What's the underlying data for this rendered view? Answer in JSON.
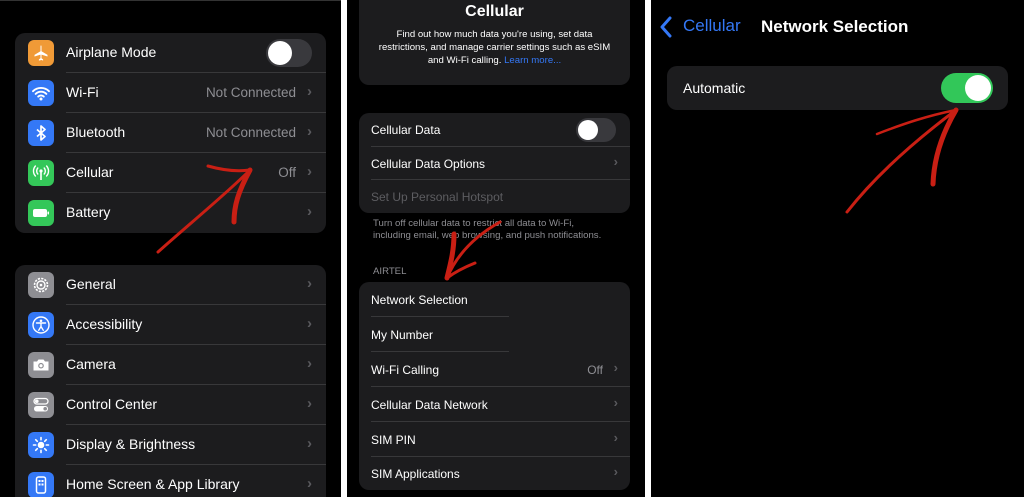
{
  "settings": {
    "group1": [
      {
        "label": "Airplane Mode",
        "icon": "airplane-icon",
        "color": "#f09a37",
        "toggle": "off"
      },
      {
        "label": "Wi-Fi",
        "value": "Not Connected",
        "icon": "wifi-icon",
        "color": "#3478f6"
      },
      {
        "label": "Bluetooth",
        "value": "Not Connected",
        "icon": "bluetooth-icon",
        "color": "#3478f6"
      },
      {
        "label": "Cellular",
        "value": "Off",
        "icon": "antenna-icon",
        "color": "#34c759"
      },
      {
        "label": "Battery",
        "icon": "battery-icon",
        "color": "#34c759"
      }
    ],
    "group2": [
      {
        "label": "General",
        "icon": "gear-icon",
        "color": "#8e8e93"
      },
      {
        "label": "Accessibility",
        "icon": "accessibility-icon",
        "color": "#3478f6"
      },
      {
        "label": "Camera",
        "icon": "camera-icon",
        "color": "#8e8e93"
      },
      {
        "label": "Control Center",
        "icon": "switches-icon",
        "color": "#8e8e93"
      },
      {
        "label": "Display & Brightness",
        "icon": "sun-icon",
        "color": "#3478f6"
      },
      {
        "label": "Home Screen & App Library",
        "icon": "phone-icon",
        "color": "#3478f6"
      }
    ]
  },
  "cellular": {
    "title": "Cellular",
    "intro": "Find out how much data you're using, set data restrictions, and manage carrier settings such as eSIM and Wi-Fi calling.",
    "learn_more": "Learn more...",
    "group1": [
      {
        "label": "Cellular Data",
        "toggle": "off"
      },
      {
        "label": "Cellular Data Options"
      },
      {
        "label": "Set Up Personal Hotspot",
        "disabled": true
      }
    ],
    "footer": "Turn off cellular data to restrict all data to Wi-Fi, including email, web browsing, and push notifications.",
    "carrier_header": "AIRTEL",
    "group2": [
      {
        "label": "Network Selection"
      },
      {
        "label": "My Number"
      },
      {
        "label": "Wi-Fi Calling",
        "value": "Off"
      },
      {
        "label": "Cellular Data Network"
      },
      {
        "label": "SIM PIN"
      },
      {
        "label": "SIM Applications"
      }
    ]
  },
  "network": {
    "back_label": "Cellular",
    "title": "Network Selection",
    "automatic_label": "Automatic",
    "automatic_state": "on"
  },
  "colors": {
    "annotation": "#c91f14",
    "link": "#3478f6",
    "toggle_on": "#32c759"
  }
}
